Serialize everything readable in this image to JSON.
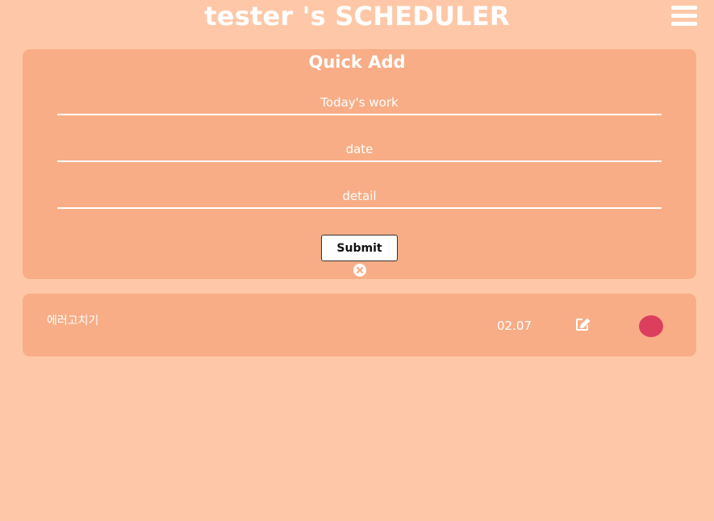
{
  "header": {
    "title": "tester 's SCHEDULER",
    "menu_icon": "hamburger-menu-icon"
  },
  "quick_add": {
    "title": "Quick Add",
    "work_placeholder": "Today's work",
    "date_placeholder": "date",
    "detail_placeholder": "detail",
    "work_value": "",
    "date_value": "",
    "detail_value": "",
    "submit_label": "Submit",
    "close_icon": "close-circle-icon"
  },
  "tasks": [
    {
      "title": "에러고치기",
      "date": "02.07",
      "edit_icon": "edit-icon",
      "status_color": "#dc3f5e"
    }
  ],
  "colors": {
    "background": "#fec8a8",
    "panel": "#f8ad86",
    "text": "#ffffff",
    "status_dot": "#dc3f5e"
  }
}
